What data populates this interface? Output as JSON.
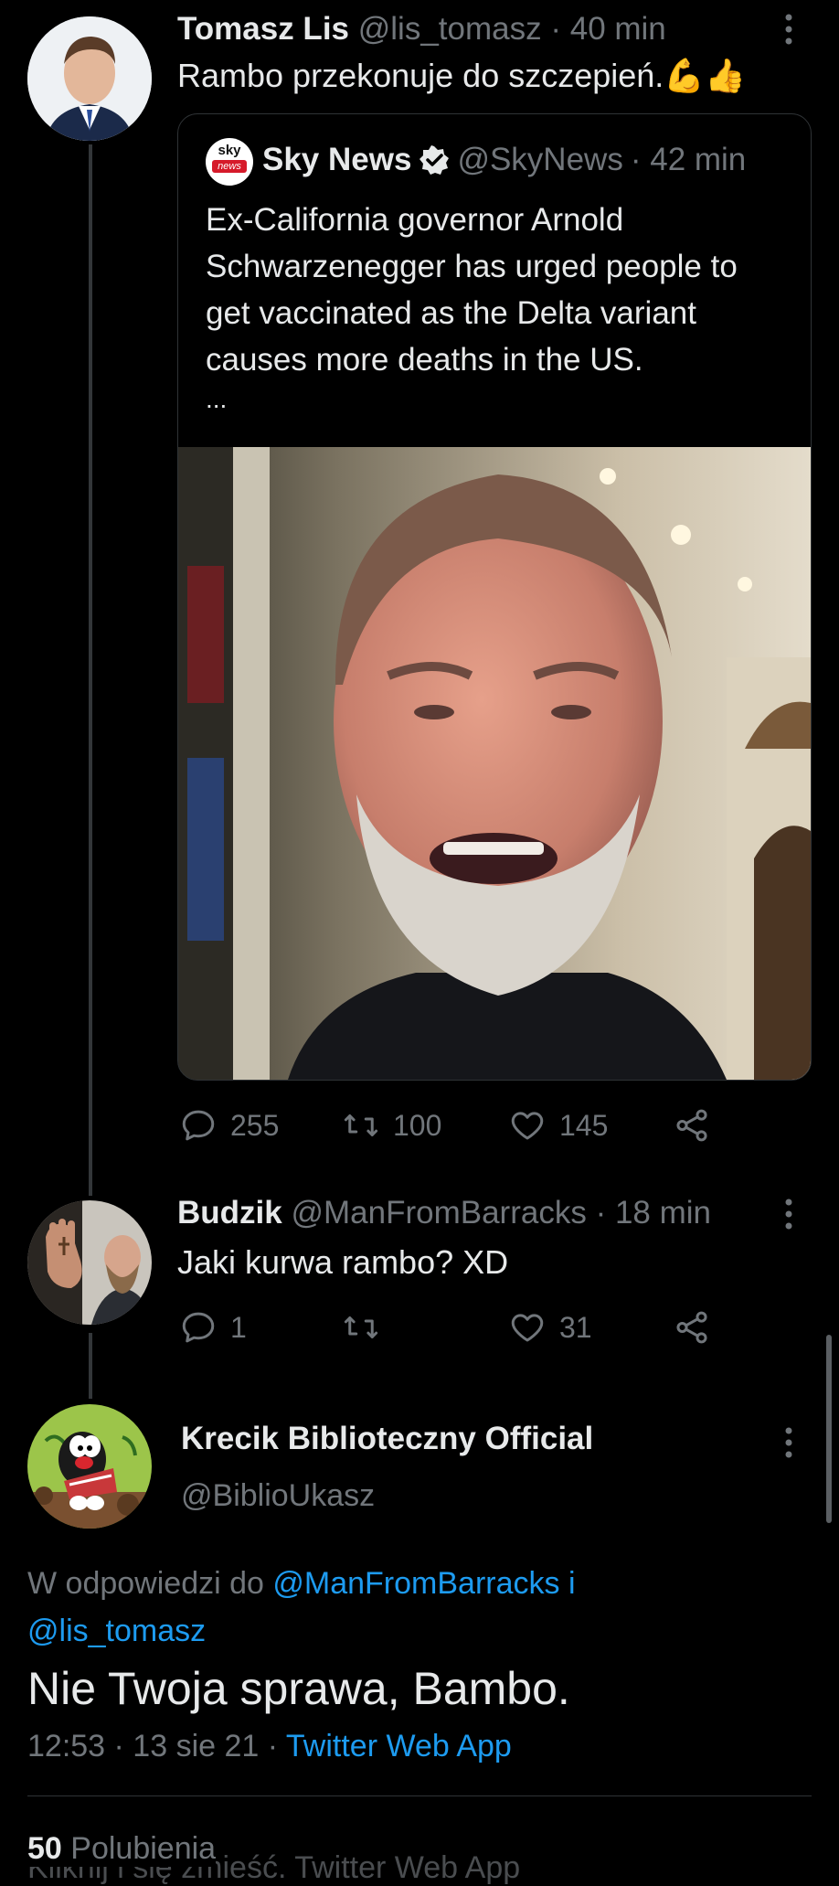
{
  "tweet1": {
    "display_name": "Tomasz Lis",
    "handle": "@lis_tomasz",
    "time": "· 40 min",
    "text": "Rambo przekonuje do szczepień.",
    "emoji": "💪👍",
    "quote": {
      "logo_top": "sky",
      "logo_bottom": "news",
      "display_name": "Sky News",
      "handle": "@SkyNews",
      "time": "· 42 min",
      "text": "Ex-California governor Arnold Schwarzenegger has urged people to get vaccinated as the Delta variant causes more deaths in the US.",
      "ellipsis": "..."
    },
    "replies": "255",
    "retweets": "100",
    "likes": "145"
  },
  "tweet2": {
    "display_name": "Budzik",
    "handle": "@ManFromBarracks",
    "time": "· 18 min",
    "text": "Jaki kurwa rambo? XD",
    "replies": "1",
    "retweets": "",
    "likes": "31"
  },
  "main_tweet": {
    "display_name": "Krecik Biblioteczny Official",
    "handle": "@BiblioUkasz",
    "reply_prefix": "W odpowiedzi do",
    "reply_to_1": "@ManFromBarracks",
    "reply_conj": "i",
    "reply_to_2": "@lis_tomasz",
    "text": "Nie Twoja sprawa, Bambo.",
    "timestamp": "12:53 · 13 sie 21 ·",
    "source": "Twitter Web App",
    "likes_count": "50",
    "likes_label": "Polubienia",
    "ghost_text": "Kliknij i się zmieść. Twitter Web App"
  },
  "colors": {
    "accent": "#1d9bf0",
    "muted": "#71767b",
    "text": "#e7e9ea",
    "bg": "#000000"
  }
}
